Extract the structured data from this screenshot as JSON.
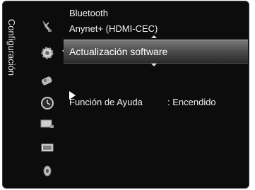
{
  "sidebar": {
    "title": "Configuración"
  },
  "icons": [
    "satellite-dish-icon",
    "gear-icon",
    "speaker-icon",
    "clock-icon",
    "input-source-icon",
    "picture-icon",
    "sound-icon"
  ],
  "menu": {
    "items": [
      {
        "label": "Bluetooth"
      },
      {
        "label": "Anynet+ (HDMI-CEC)"
      },
      {
        "label": "Actualización software",
        "selected": true
      }
    ],
    "help_label": "Función de Ayuda",
    "help_value": ": Encendido"
  },
  "colors": {
    "background": "#0c0c0c",
    "highlight": "#5a5a5a",
    "text": "#f2f2f2"
  }
}
